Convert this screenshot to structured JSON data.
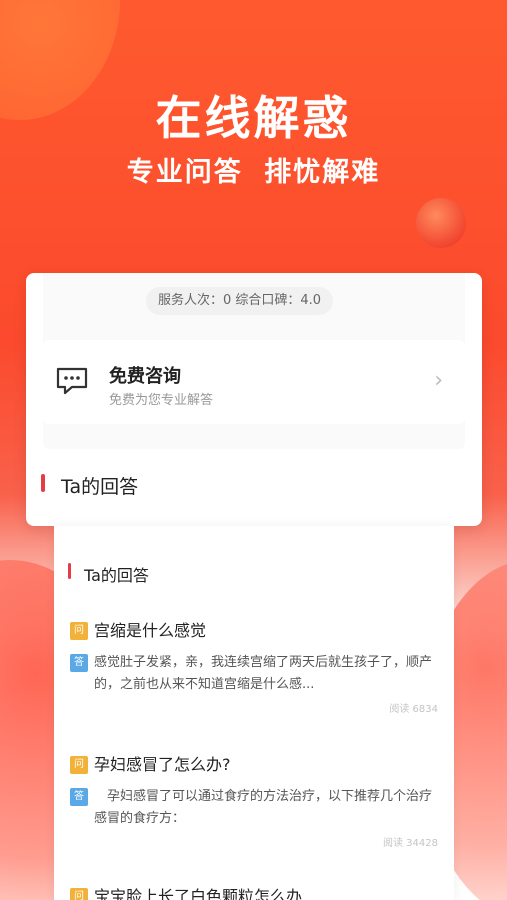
{
  "hero": {
    "title": "在线解惑",
    "subtitle": "专业问答  排忧解难"
  },
  "stats": {
    "text": "服务人次：0  综合口碑：4.0"
  },
  "consult": {
    "title": "免费咨询",
    "subtitle": "免费为您专业解答",
    "icon": "chat-bubble-icon",
    "arrow": "›"
  },
  "card_section": {
    "title": "Ta的回答"
  },
  "sheet_section": {
    "title": "Ta的回答"
  },
  "badges": {
    "question": "问",
    "answer": "答"
  },
  "qa": [
    {
      "question": "宫缩是什么感觉",
      "answer": "感觉肚子发紧，亲，我连续宫缩了两天后就生孩子了，顺产的，之前也从来不知道宫缩是什么感...",
      "read": "阅读 6834"
    },
    {
      "question": "孕妇感冒了怎么办?",
      "answer": "　孕妇感冒了可以通过食疗的方法治疗，以下推荐几个治疗感冒的食疗方：",
      "read": "阅读 34428"
    },
    {
      "question": "宝宝脸上长了白色颗粒怎么办"
    }
  ],
  "colors": {
    "accent": "#e63c47",
    "hero": "#fb4a2d",
    "badge_q": "#f2b23a",
    "badge_a": "#5aa9e6"
  }
}
